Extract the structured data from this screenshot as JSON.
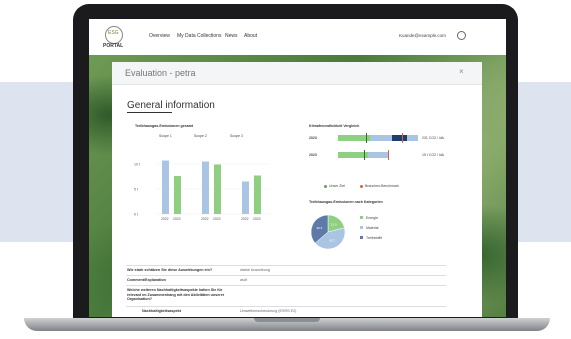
{
  "nav": {
    "logo_top": "ESG",
    "logo_bottom": "PORTAL",
    "items": [
      "Overview",
      "My Data Collections",
      "News",
      "About"
    ],
    "user_email": "Kuande@example.com"
  },
  "modal": {
    "title": "Evaluation - petra",
    "close": "×",
    "section_title": "General information"
  },
  "left_chart": {
    "title": "Treibhausgas-Emissionen gesamt",
    "legend": [
      "Scope 1",
      "Scope 2",
      "Scope 3"
    ],
    "y_ticks": [
      "10 t",
      "5 t",
      "0 t"
    ],
    "chart_data": {
      "type": "bar",
      "categories": [
        "2022",
        "2023",
        "2022",
        "2023",
        "2022",
        "2023"
      ],
      "series": [
        {
          "name": "Scope 1",
          "values": [
            10.7,
            7.6
          ]
        },
        {
          "name": "Scope 2",
          "values": [
            10.5,
            9.9
          ]
        },
        {
          "name": "Scope 3",
          "values": [
            6.5,
            7.7
          ]
        }
      ],
      "colors": [
        "#a9c5e3",
        "#8fcf82"
      ],
      "ylim": [
        0,
        12
      ]
    }
  },
  "right_chart": {
    "title": "Klimafreundlichkeit Vergleich",
    "rows": [
      {
        "year": "2023",
        "value_label": "231 CO2 / ldA",
        "green_frac": 0.4,
        "blue_frac": 1.0,
        "dark_from": 0.68,
        "dark_to": 0.86,
        "target_frac": 0.35,
        "bench_frac": 0.8
      },
      {
        "year": "2023",
        "value_label": "15 t CO2 / ldA",
        "green_frac": 0.38,
        "blue_frac": 0.64,
        "dark_from": 0,
        "dark_to": 0,
        "target_frac": 0.32,
        "bench_frac": 0.62
      }
    ],
    "legend": [
      "Unser Ziel",
      "Branchen-Benchmark"
    ],
    "legend_colors": [
      "#5aa84b",
      "#e0603a"
    ]
  },
  "pie_chart": {
    "title": "Treibhausgas-Emissionen nach Kategorien",
    "chart_data": {
      "type": "pie",
      "labels": [
        "Energie",
        "Material",
        "Treibstoffe"
      ],
      "values": [
        21.0,
        42.7,
        36.3
      ],
      "display": [
        "21.0",
        "42.7",
        "36.3"
      ],
      "colors": [
        "#8fcf82",
        "#a9c5e3",
        "#5e7aa8"
      ]
    }
  },
  "qa": [
    {
      "q": "Wie stark schätzen Sie diese Auswirkungen ein?",
      "a": "starke Auswirkung"
    },
    {
      "q": "Comment/Explanation",
      "a": "asdf"
    },
    {
      "q": "Welche weiteren Nachhaltigkeitsaspekte halten Sie für relevant im Zusammenhang mit den Aktivitäten unserer Organisation?",
      "a": ""
    },
    {
      "q": "Nachhaltigkeitsaspekt",
      "a": "Umweltverschmutzung (ESRS E2)"
    }
  ]
}
